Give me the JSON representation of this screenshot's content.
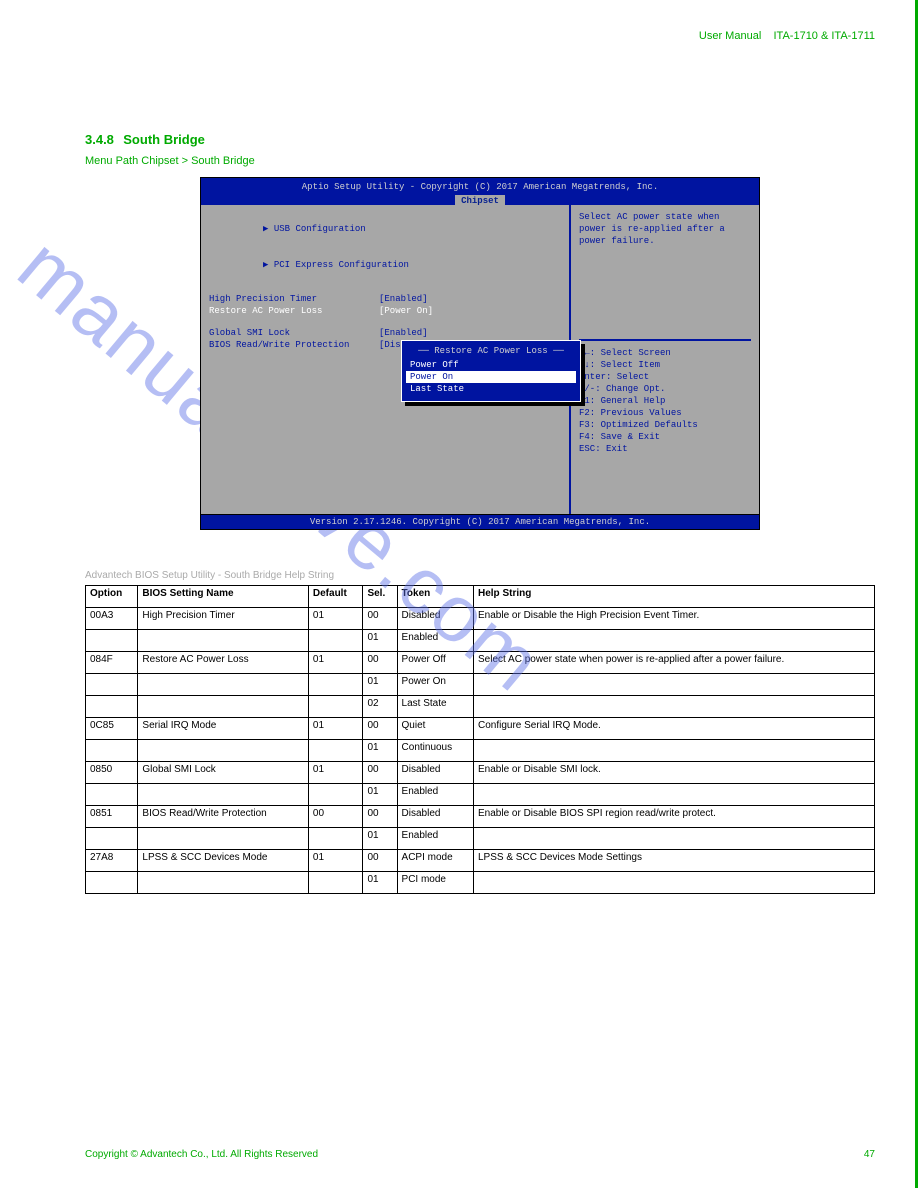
{
  "page_header": {
    "left": "User Manual",
    "right": "ITA-1710 & ITA-1711"
  },
  "section": {
    "number": "3.4.8",
    "title": "South Bridge",
    "menu_label": "Menu Path     Chipset > South Bridge"
  },
  "bios": {
    "title": "Aptio Setup Utility - Copyright (C) 2017 American Megatrends, Inc.",
    "tab": "Chipset",
    "left": {
      "link_usb": "USB Configuration",
      "link_pci": "PCI Express Configuration",
      "items": [
        {
          "label": "High Precision Timer",
          "value": "[Enabled]"
        },
        {
          "label": "Restore AC Power Loss",
          "value": "[Power On]",
          "highlighted": true
        },
        {
          "label": "Global SMI Lock",
          "value": "[Enabled]"
        },
        {
          "label": "BIOS Read/Write Protection",
          "value": "[Disabled]"
        }
      ]
    },
    "help": "Select AC power state when power is re-applied after a power failure.",
    "keys": "→←: Select Screen\n↑↓: Select Item\nEnter: Select\n+/-: Change Opt.\nF1: General Help\nF2: Previous Values\nF3: Optimized Defaults\nF4: Save & Exit\nESC: Exit",
    "popup": {
      "title": "Restore AC Power Loss",
      "options": [
        "Power Off",
        "Power On",
        "Last State"
      ],
      "active": 1
    },
    "footer": "Version 2.17.1246. Copyright (C) 2017 American Megatrends, Inc."
  },
  "helpstring": "Advantech BIOS Setup Utility - South Bridge Help String",
  "table": {
    "headers": [
      "Option",
      "BIOS Setting Name",
      "Default",
      "Sel.",
      "Token",
      "Help String"
    ],
    "rows": [
      [
        "00A3",
        "High Precision Timer",
        "01",
        "00",
        "Disabled",
        "Enable or Disable the High Precision Event Timer."
      ],
      [
        "",
        "",
        "",
        "01",
        "Enabled",
        ""
      ],
      [
        "084F",
        "Restore AC Power Loss",
        "01",
        "00",
        "Power Off",
        "Select AC power state when power is re-applied after a power failure."
      ],
      [
        "",
        "",
        "",
        "01",
        "Power On",
        ""
      ],
      [
        "",
        "",
        "",
        "02",
        "Last State",
        ""
      ],
      [
        "0C85",
        "Serial IRQ Mode",
        "01",
        "00",
        "Quiet",
        "Configure Serial IRQ Mode."
      ],
      [
        "",
        "",
        "",
        "01",
        "Continuous",
        ""
      ],
      [
        "0850",
        "Global SMI Lock",
        "01",
        "00",
        "Disabled",
        "Enable or Disable SMI lock."
      ],
      [
        "",
        "",
        "",
        "01",
        "Enabled",
        ""
      ],
      [
        "0851",
        "BIOS Read/Write Protection",
        "00",
        "00",
        "Disabled",
        "Enable or Disable BIOS SPI region read/write protect."
      ],
      [
        "",
        "",
        "",
        "01",
        "Enabled",
        ""
      ],
      [
        "27A8",
        "LPSS & SCC Devices Mode",
        "01",
        "00",
        "ACPI mode",
        "LPSS & SCC Devices Mode Settings"
      ],
      [
        "",
        "",
        "",
        "01",
        "PCI mode",
        ""
      ]
    ]
  },
  "footer": {
    "left": "Copyright © Advantech Co., Ltd. All Rights Reserved",
    "right": "47"
  },
  "watermark": "manualshive.com"
}
